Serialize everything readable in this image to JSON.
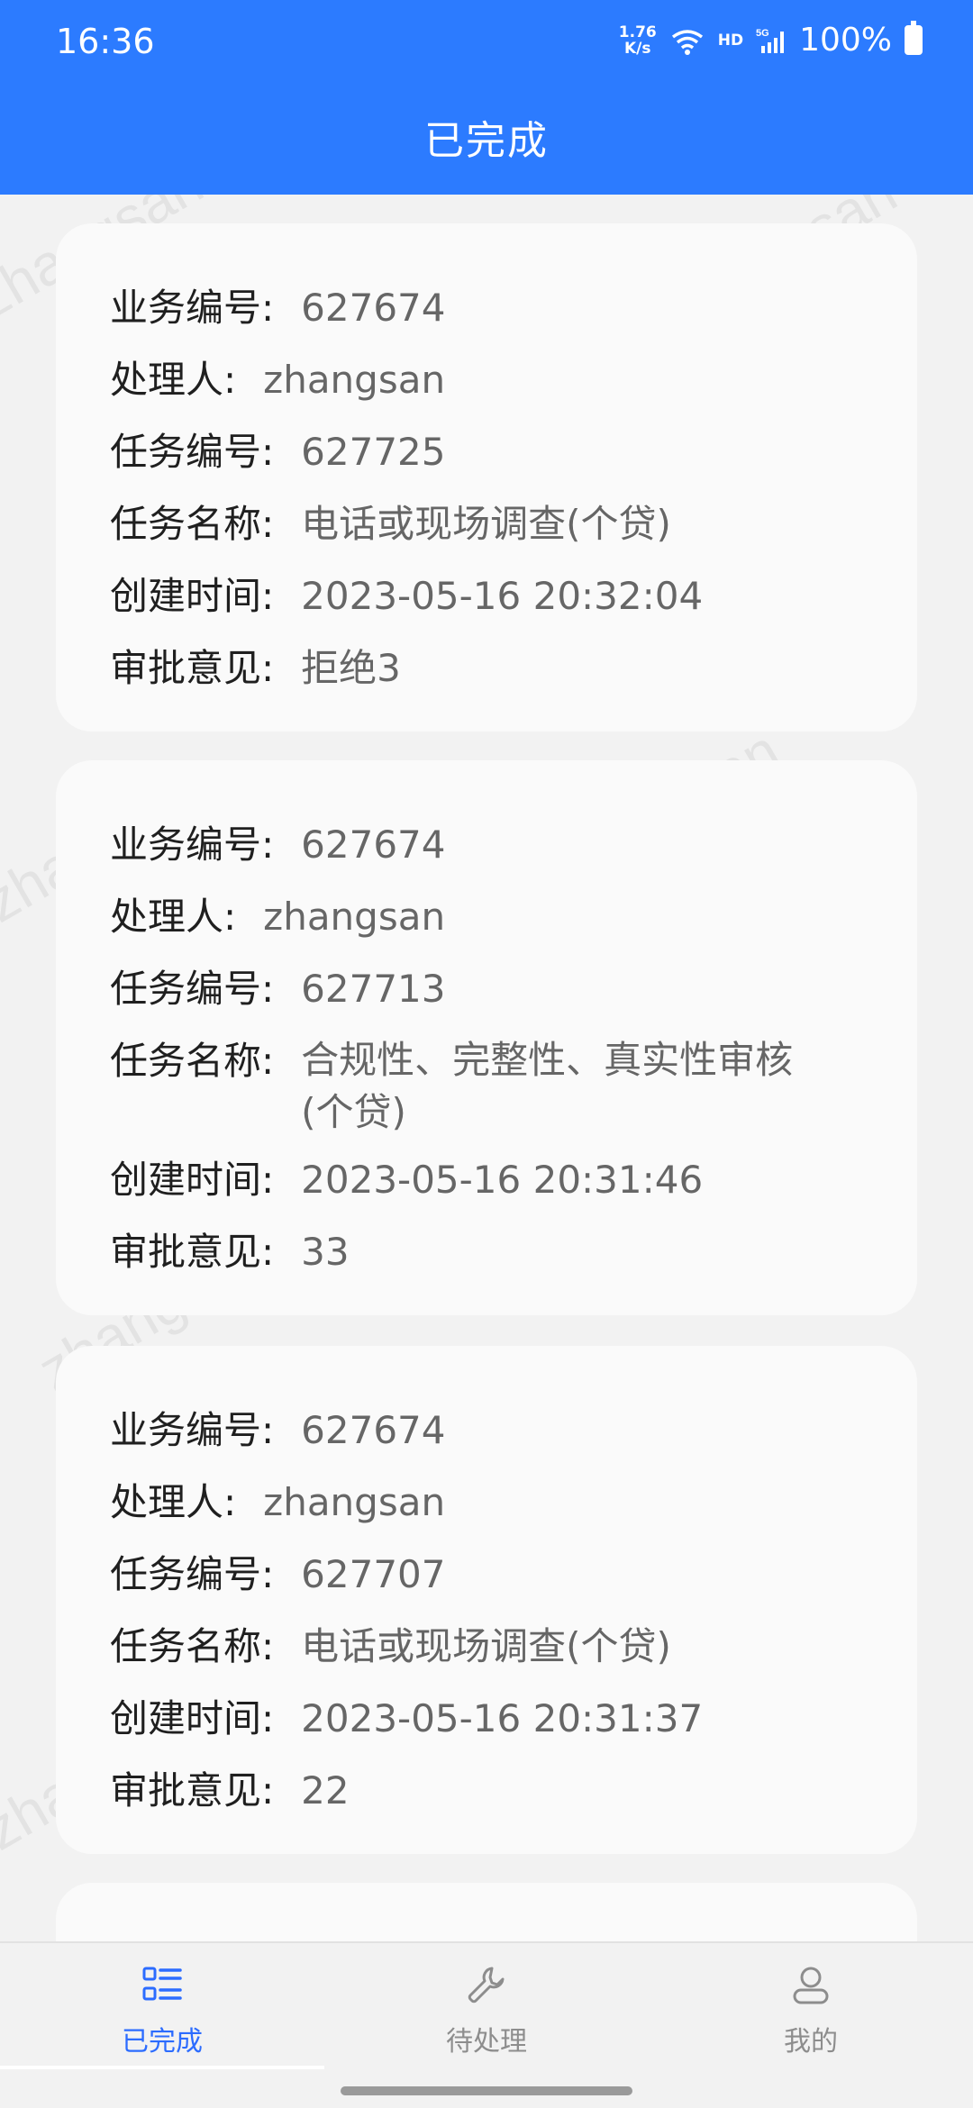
{
  "status": {
    "time": "16:36",
    "net_speed_top": "1.76",
    "net_speed_bottom": "K/s",
    "hd": "HD",
    "battery": "100%"
  },
  "page_title": "已完成",
  "labels": {
    "business_no": "业务编号:",
    "handler": "处理人:",
    "task_no": "任务编号:",
    "task_name": "任务名称:",
    "created_at": "创建时间:",
    "approval": "审批意见:"
  },
  "records": [
    {
      "business_no": "627674",
      "handler": "zhangsan",
      "task_no": "627725",
      "task_name": "电话或现场调查(个贷)",
      "created_at": "2023-05-16 20:32:04",
      "approval": "拒绝3"
    },
    {
      "business_no": "627674",
      "handler": "zhangsan",
      "task_no": "627713",
      "task_name": "合规性、完整性、真实性审核(个贷)",
      "created_at": "2023-05-16 20:31:46",
      "approval": "33"
    },
    {
      "business_no": "627674",
      "handler": "zhangsan",
      "task_no": "627707",
      "task_name": "电话或现场调查(个贷)",
      "created_at": "2023-05-16 20:31:37",
      "approval": "22"
    }
  ],
  "watermark": "zhangsan",
  "tabs": [
    {
      "label": "已完成",
      "icon": "list-icon"
    },
    {
      "label": "待处理",
      "icon": "wrench-icon"
    },
    {
      "label": "我的",
      "icon": "person-icon"
    }
  ],
  "colors": {
    "primary": "#2c7bff",
    "active_tab": "#2c6cff"
  }
}
